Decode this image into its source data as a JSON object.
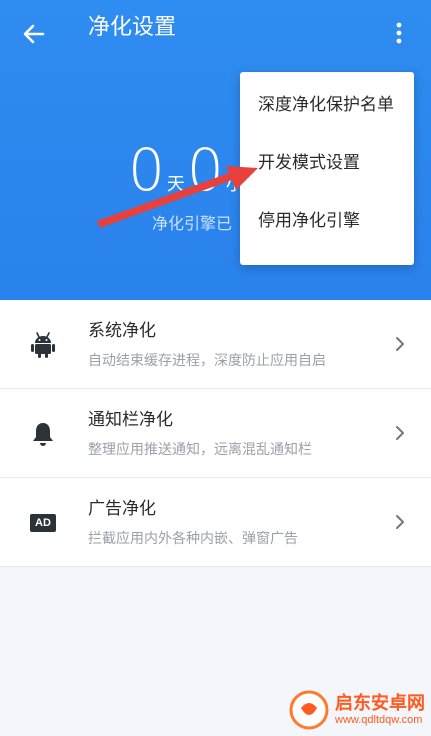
{
  "header": {
    "title": "净化设置",
    "back_icon": "arrow-left-icon",
    "more_icon": "more-vertical-icon",
    "color": "#2f8cf0"
  },
  "runtime": {
    "days": "0",
    "days_unit": "天",
    "hours": "0",
    "hours_unit": "小",
    "status": "净化引擎已"
  },
  "menu": {
    "items": [
      {
        "label": "深度净化保护名单"
      },
      {
        "label": "开发模式设置"
      },
      {
        "label": "停用净化引擎"
      }
    ]
  },
  "list": {
    "items": [
      {
        "icon": "android-icon",
        "title": "系统净化",
        "subtitle": "自动结束缓存进程，深度防止应用自启"
      },
      {
        "icon": "bell-icon",
        "title": "通知栏净化",
        "subtitle": "整理应用推送通知，远离混乱通知栏"
      },
      {
        "icon": "ad-icon",
        "icon_text": "AD",
        "title": "广告净化",
        "subtitle": "拦截应用内外各种内嵌、弹窗广告"
      }
    ]
  },
  "annotation": {
    "arrow_color": "#e8403a"
  },
  "watermark": {
    "title": "启东安卓网",
    "url": "www.qdltdqw.com"
  }
}
